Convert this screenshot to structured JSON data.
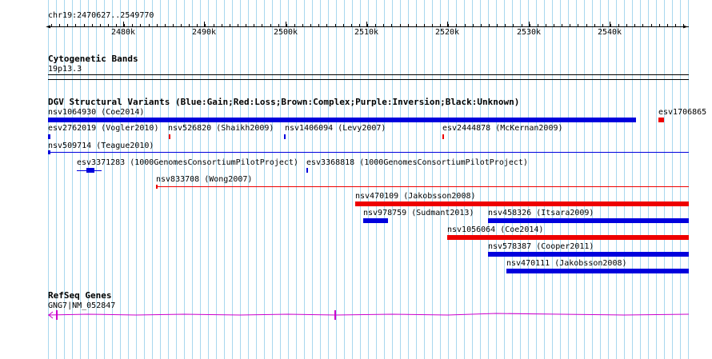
{
  "ruler": {
    "location": "chr19:2470627..2549770",
    "ticks": [
      "2480k",
      "2490k",
      "2500k",
      "2510k",
      "2520k",
      "2530k",
      "2540k"
    ],
    "left_arrow": "◄",
    "right_arrow": "►"
  },
  "cytoband": {
    "title": "Cytogenetic Bands",
    "band": "19p13.3"
  },
  "dgv": {
    "title": "DGV Structural Variants (Blue:Gain;Red:Loss;Brown:Complex;Purple:Inversion;Black:Unknown)",
    "colors": {
      "gain": "#0000dd",
      "loss": "#ee0000"
    },
    "features": [
      {
        "label": "nsv1064930 (Coe2014)",
        "type": "gain"
      },
      {
        "label": "esv1706865",
        "type": "loss"
      },
      {
        "label": "esv2762019 (Vogler2010)",
        "type": "gain"
      },
      {
        "label": "nsv526820 (Shaikh2009)",
        "type": "loss"
      },
      {
        "label": "nsv1406094 (Levy2007)",
        "type": "gain"
      },
      {
        "label": "esv2444878 (McKernan2009)",
        "type": "loss"
      },
      {
        "label": "nsv509714 (Teague2010)",
        "type": "gain"
      },
      {
        "label": "esv3371283 (1000GenomesConsortiumPilotProject)",
        "type": "gain"
      },
      {
        "label": "esv3368818 (1000GenomesConsortiumPilotProject)",
        "type": "gain"
      },
      {
        "label": "nsv833708 (Wong2007)",
        "type": "loss"
      },
      {
        "label": "nsv470109 (Jakobsson2008)",
        "type": "loss"
      },
      {
        "label": "nsv978759 (Sudmant2013)",
        "type": "gain"
      },
      {
        "label": "nsv458326 (Itsara2009)",
        "type": "gain"
      },
      {
        "label": "nsv1056064 (Coe2014)",
        "type": "loss"
      },
      {
        "label": "nsv578387 (Cooper2011)",
        "type": "gain"
      },
      {
        "label": "nsv470111 (Jakobsson2008)",
        "type": "gain"
      }
    ]
  },
  "refseq": {
    "title": "RefSeq Genes",
    "gene": "GNG7|NM_052847",
    "color": "#cc00cc"
  },
  "colors": {
    "grid": "#a8d8ee",
    "ruler": "#000000"
  }
}
